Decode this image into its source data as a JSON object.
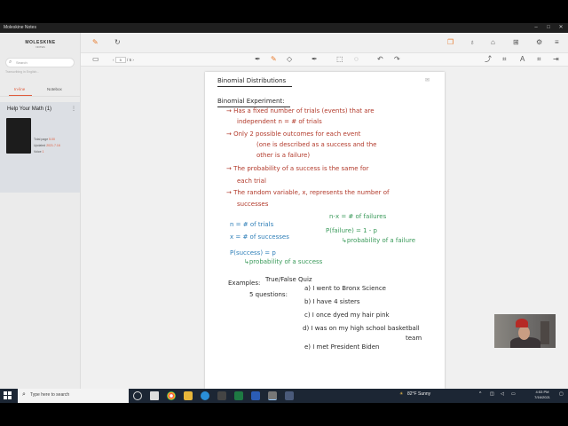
{
  "window": {
    "title": "Moleskine Notes"
  },
  "sidebar": {
    "logo": "MOLESKINE",
    "logo_sub": "NOTES",
    "search_placeholder": "Search",
    "search_hint": "Transcribing in English...",
    "tabs": [
      "In-line",
      "Notebox"
    ],
    "notebook": {
      "title": "Help Your Math (1)",
      "total_label": "Total page",
      "total_value": "5.00",
      "updated_label": "Updated",
      "updated_value": "2021.7.16",
      "voice_label": "Voice",
      "voice_value": "1"
    }
  },
  "toolbar": {
    "page_current": "5",
    "page_total": "5"
  },
  "note": {
    "title": "Binomial Distributions",
    "lines_black_1": [
      "Binomial Experiment:"
    ],
    "lines_red": [
      "→ Has a fixed number of trials (events) that are",
      "independent    n = # of trials",
      "→ Only 2 possible outcomes for each event",
      "(one is described as a success and the",
      "other is a failure)",
      "→ The probability of a success is the same for",
      "each trial",
      "→ The random variable, x, represents the number of",
      "successes"
    ],
    "lines_blue": [
      "n = # of trials",
      "x = # of successes",
      "P(success) = p",
      "↳probability of a success"
    ],
    "lines_green": [
      "n-x = # of failures",
      "P(failure) = 1 - p",
      "↳probability of a failure"
    ],
    "examples_label": "Examples:",
    "quiz_label": "True/False Quiz",
    "questions_label": "5 questions:",
    "questions": [
      "a) I went to Bronx Science",
      "b) I have 4 sisters",
      "c) I once dyed my hair pink",
      "d) I was on my high school basketball",
      "team",
      "e) I met President Biden"
    ]
  },
  "taskbar": {
    "search_placeholder": "Type here to search",
    "weather": "82°F Sunny",
    "time": "4:53 PM",
    "date": "7/16/2021"
  }
}
